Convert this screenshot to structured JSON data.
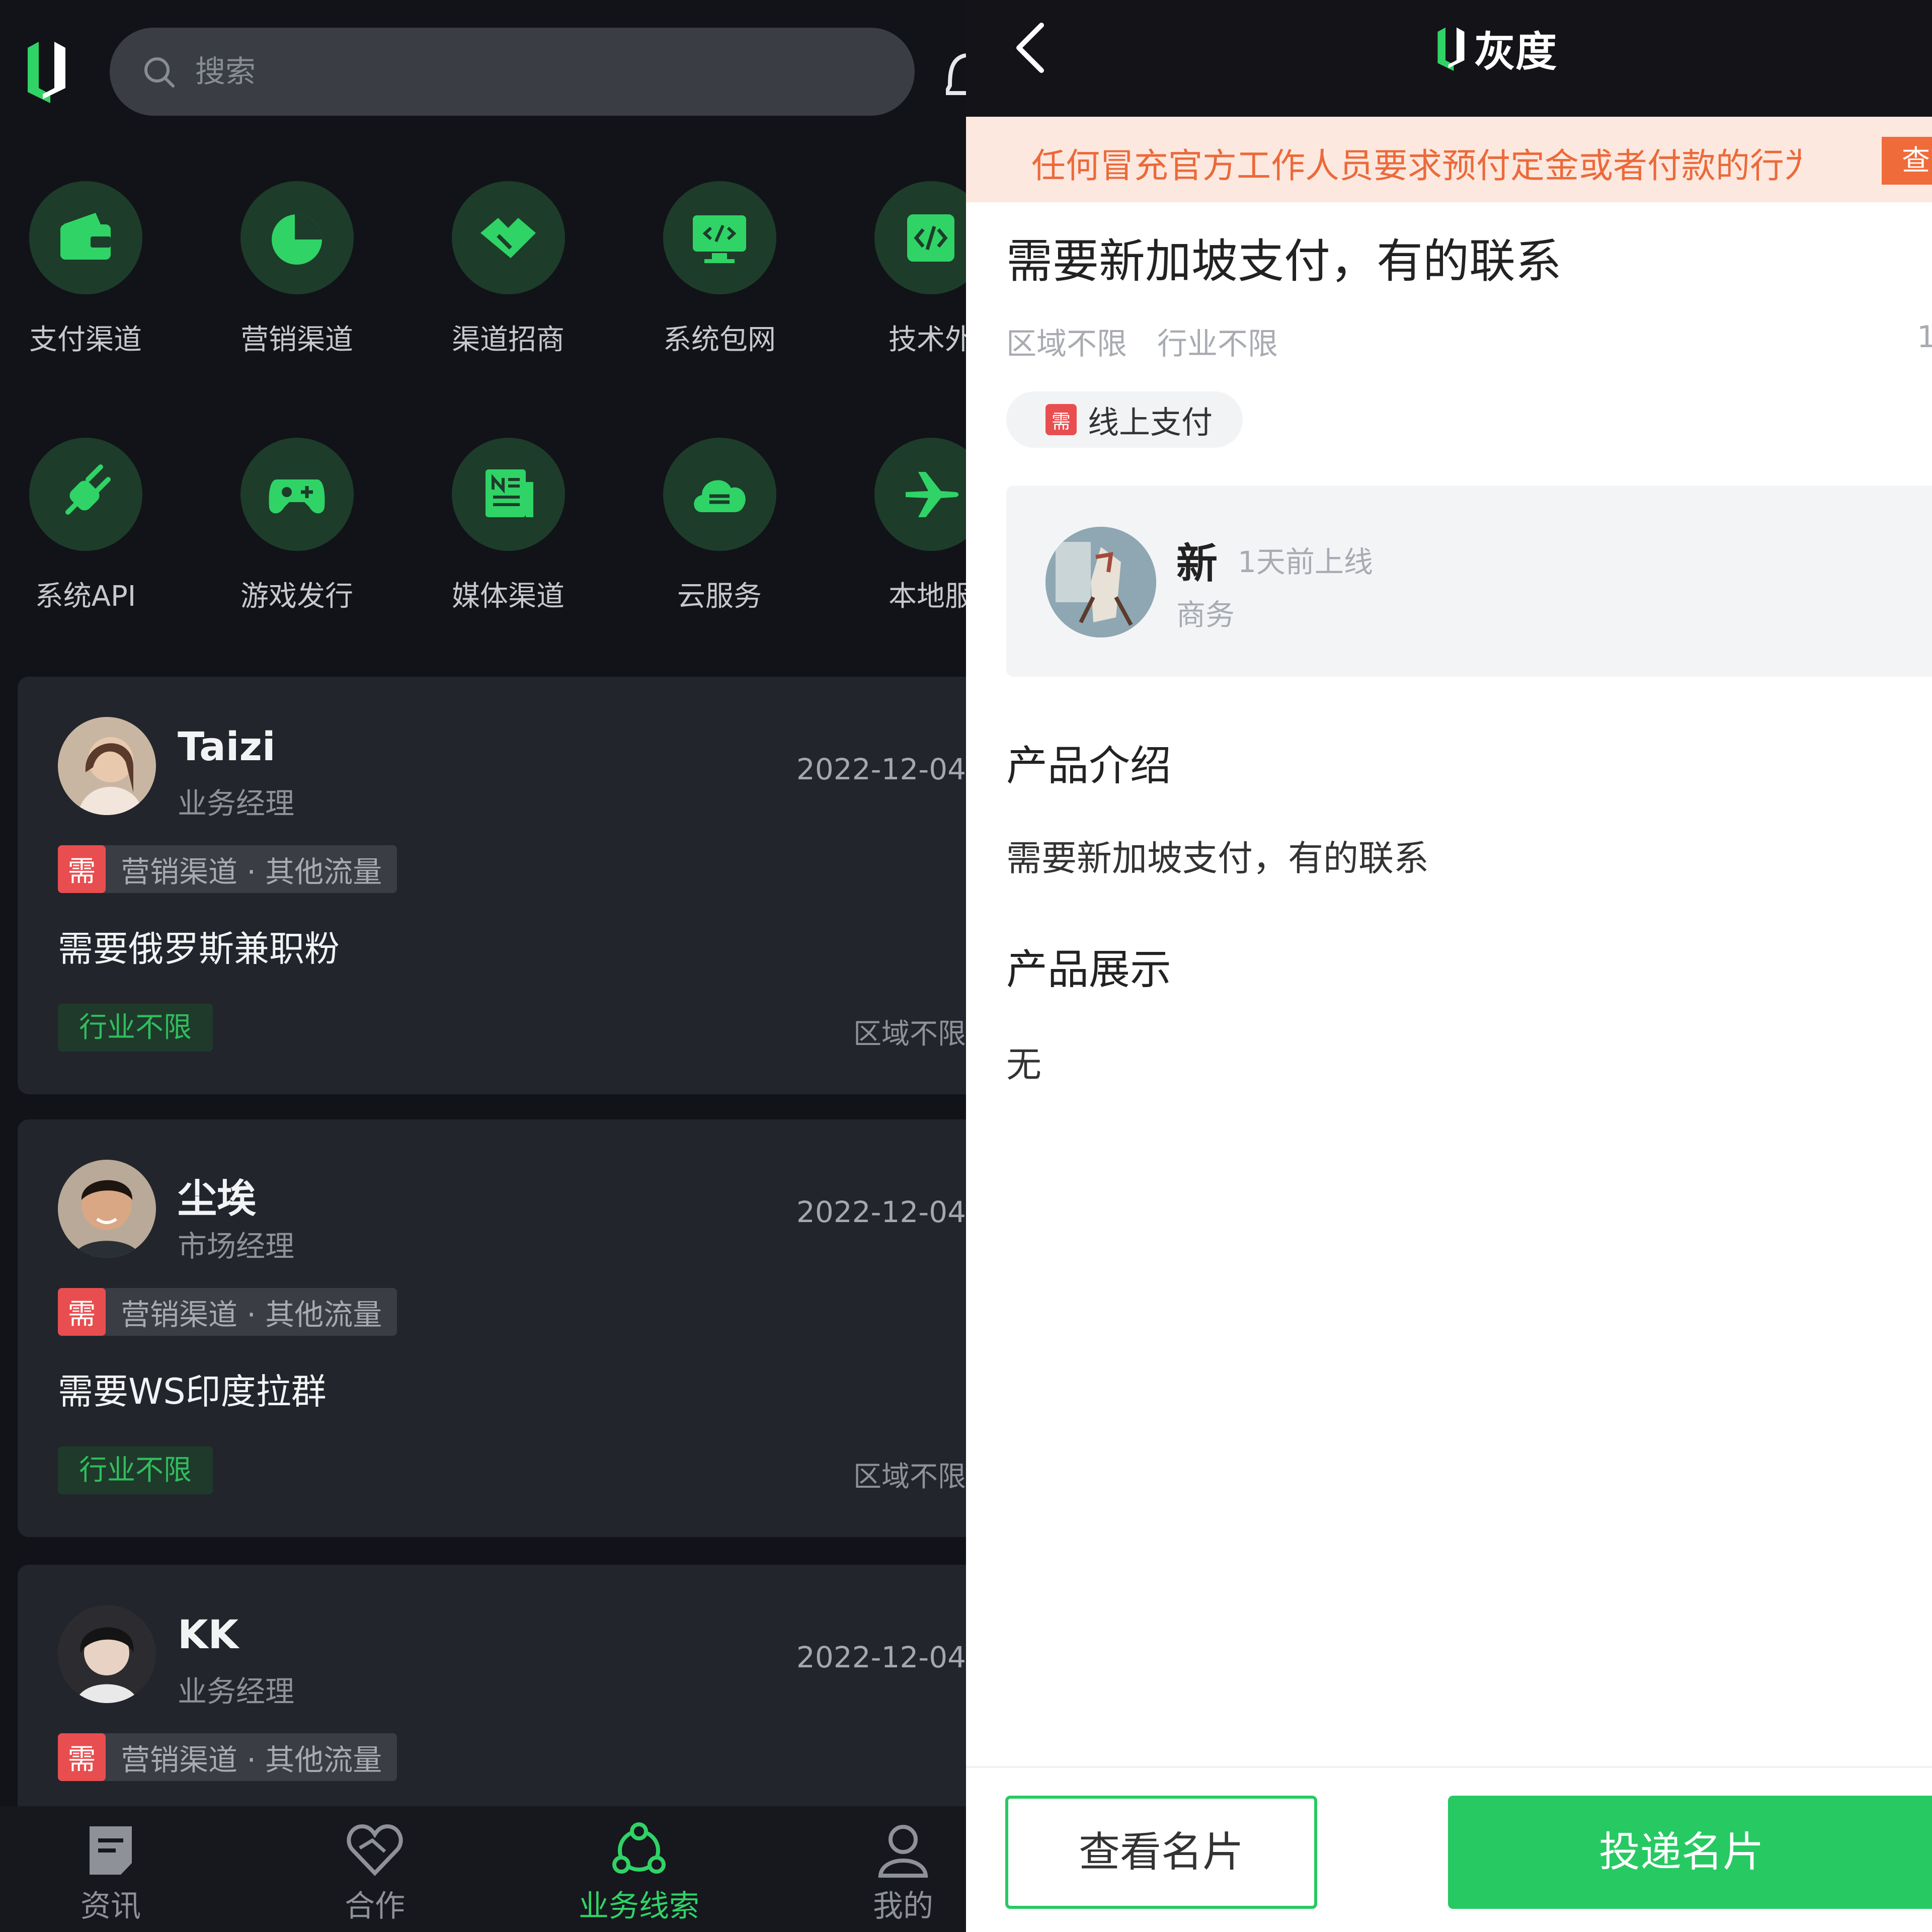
{
  "left": {
    "search": {
      "placeholder": "搜索"
    },
    "categories": [
      {
        "label": "支付渠道",
        "icon": "wallet-icon"
      },
      {
        "label": "营销渠道",
        "icon": "pie-chart-icon"
      },
      {
        "label": "渠道招商",
        "icon": "handshake-icon"
      },
      {
        "label": "系统包网",
        "icon": "monitor-code-icon"
      },
      {
        "label": "技术外",
        "icon": "code-icon"
      },
      {
        "label": "系统API",
        "icon": "plug-icon"
      },
      {
        "label": "游戏发行",
        "icon": "gamepad-icon"
      },
      {
        "label": "媒体渠道",
        "icon": "newspaper-icon"
      },
      {
        "label": "云服务",
        "icon": "cloud-icon"
      },
      {
        "label": "本地服",
        "icon": "airplane-icon"
      }
    ],
    "cards": [
      {
        "name": "Taizi",
        "role": "业务经理",
        "date": "2022-12-04",
        "need_badge": "需",
        "tag": "营销渠道 · 其他流量",
        "desc": "需要俄罗斯兼职粉",
        "industry": "行业不限",
        "region": "区域不限"
      },
      {
        "name": "尘埃",
        "role": "市场经理",
        "date": "2022-12-04",
        "need_badge": "需",
        "tag": "营销渠道 · 其他流量",
        "desc": "需要WS印度拉群",
        "industry": "行业不限",
        "region": "区域不限"
      },
      {
        "name": "KK",
        "role": "业务经理",
        "date": "2022-12-04",
        "need_badge": "需",
        "tag": "营销渠道 · 其他流量"
      }
    ],
    "nav": [
      {
        "label": "资讯",
        "icon": "news-icon",
        "active": false
      },
      {
        "label": "合作",
        "icon": "heart-handshake-icon",
        "active": false
      },
      {
        "label": "业务线索",
        "icon": "network-icon",
        "active": true
      },
      {
        "label": "我的",
        "icon": "person-icon",
        "active": false
      }
    ]
  },
  "right": {
    "brand": "灰度",
    "notice": "任何冒充官方工作人员要求预付定金或者付款的行为",
    "notice_button": "查",
    "title": "需要新加坡支付，有的联系",
    "meta": {
      "region": "区域不限",
      "industry": "行业不限",
      "trailing": "1"
    },
    "chip": {
      "badge": "需",
      "label": "线上支付"
    },
    "user": {
      "name": "新",
      "online": "1天前上线",
      "role": "商务"
    },
    "intro_heading": "产品介绍",
    "intro_body": "需要新加坡支付，有的联系",
    "showcase_heading": "产品展示",
    "showcase_body": "无",
    "btn_view": "查看名片",
    "btn_send": "投递名片"
  },
  "colors": {
    "accent": "#26c962",
    "need_red": "#e84d4f",
    "notice_orange": "#ec6a3a",
    "dark_bg": "#111318"
  }
}
